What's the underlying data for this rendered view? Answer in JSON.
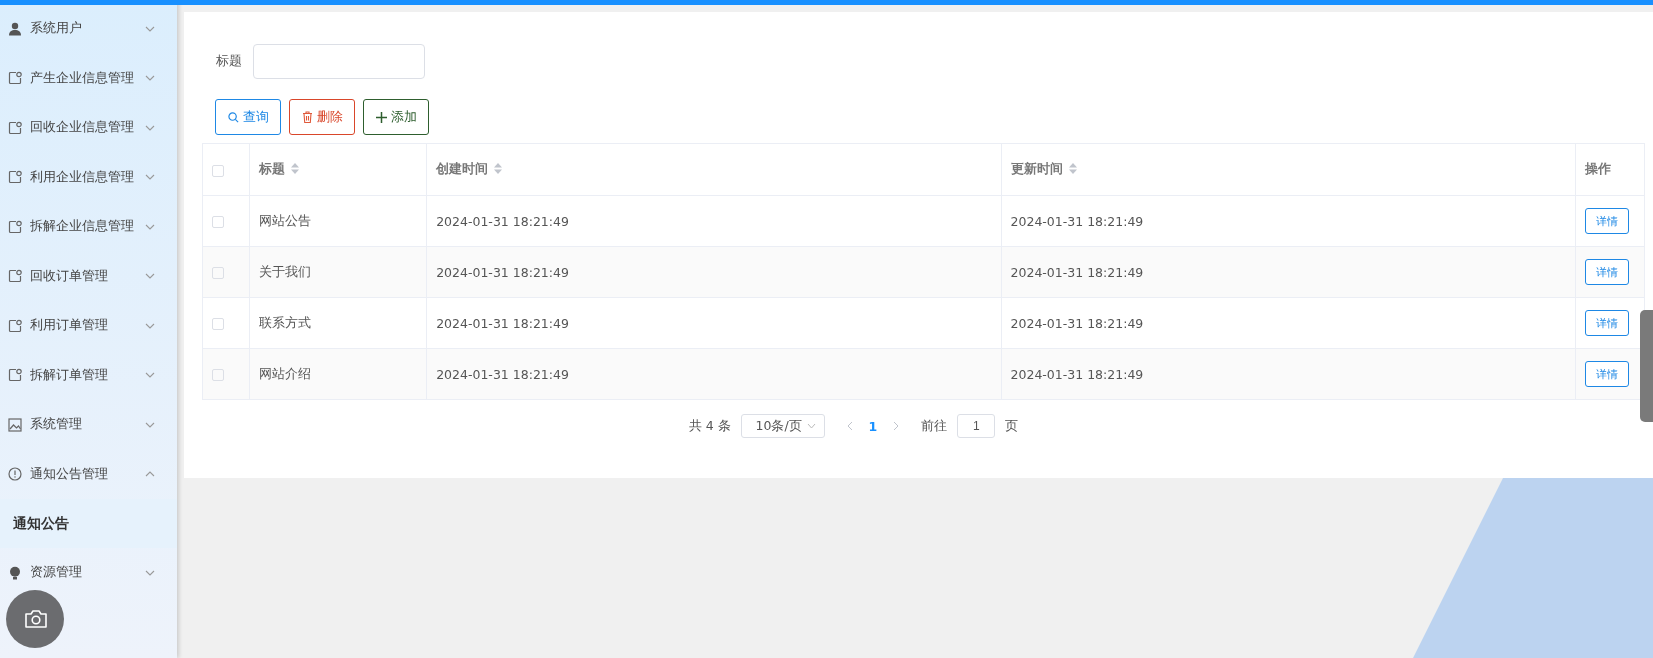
{
  "sidebar": {
    "items": [
      {
        "label": "系统用户",
        "kind": "user",
        "expanded": false
      },
      {
        "label": "产生企业信息管理",
        "kind": "doc",
        "expanded": false
      },
      {
        "label": "回收企业信息管理",
        "kind": "doc",
        "expanded": false
      },
      {
        "label": "利用企业信息管理",
        "kind": "doc",
        "expanded": false
      },
      {
        "label": "拆解企业信息管理",
        "kind": "doc",
        "expanded": false
      },
      {
        "label": "回收订单管理",
        "kind": "doc",
        "expanded": false
      },
      {
        "label": "利用订单管理",
        "kind": "doc",
        "expanded": false
      },
      {
        "label": "拆解订单管理",
        "kind": "doc",
        "expanded": false
      },
      {
        "label": "系统管理",
        "kind": "image",
        "expanded": false
      },
      {
        "label": "通知公告管理",
        "kind": "info",
        "expanded": true,
        "children": [
          {
            "label": "通知公告",
            "selected": true
          }
        ]
      },
      {
        "label": "资源管理",
        "kind": "bulb",
        "expanded": false
      }
    ]
  },
  "search": {
    "label": "标题"
  },
  "buttons": [
    {
      "label": "查询",
      "kind": "search"
    },
    {
      "label": "删除",
      "kind": "delete"
    },
    {
      "label": "添加",
      "kind": "add"
    }
  ],
  "table": {
    "all_checked": false,
    "columns": [
      {
        "label": "标题",
        "sortable": true
      },
      {
        "label": "创建时间",
        "sortable": true
      },
      {
        "label": "更新时间",
        "sortable": true
      },
      {
        "label": "操作",
        "sortable": false
      }
    ],
    "rows": [
      {
        "checked": false,
        "title": "网站公告",
        "created": "2024-01-31 18:21:49",
        "updated": "2024-01-31 18:21:49",
        "action": "详情"
      },
      {
        "checked": false,
        "title": "关于我们",
        "created": "2024-01-31 18:21:49",
        "updated": "2024-01-31 18:21:49",
        "action": "详情"
      },
      {
        "checked": false,
        "title": "联系方式",
        "created": "2024-01-31 18:21:49",
        "updated": "2024-01-31 18:21:49",
        "action": "详情"
      },
      {
        "checked": false,
        "title": "网站介绍",
        "created": "2024-01-31 18:21:49",
        "updated": "2024-01-31 18:21:49",
        "action": "详情"
      }
    ]
  },
  "pagination": {
    "total": "共 4 条",
    "page_size": "10条/页",
    "pages": [
      {
        "label": "1",
        "selected": true
      }
    ],
    "goto_label": "前往",
    "goto_value": "1",
    "goto_suffix": "页"
  }
}
